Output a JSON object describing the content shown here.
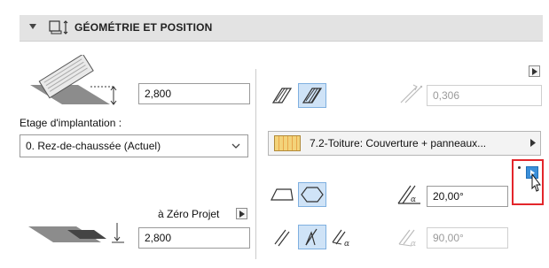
{
  "header": {
    "title": "GÉOMÉTRIE ET POSITION",
    "expand_icon": "triangle-down-icon",
    "section_icon": "geometry-position-icon"
  },
  "left": {
    "top_height": "2,800",
    "story_label": "Etage d'implantation :",
    "story_value": "0. Rez-de-chaussée (Actuel)",
    "reference_label": "à Zéro Projet",
    "bottom_height": "2,800"
  },
  "right": {
    "thickness_value": "0,306",
    "material": "7.2-Toiture: Couverture + panneaux...",
    "pitch_value": "20,00°",
    "angle_value": "90,00°"
  },
  "colors": {
    "accent": "#3b8fd9",
    "highlight_border": "#e3262b",
    "active_tool_bg": "#cfe3f7"
  }
}
